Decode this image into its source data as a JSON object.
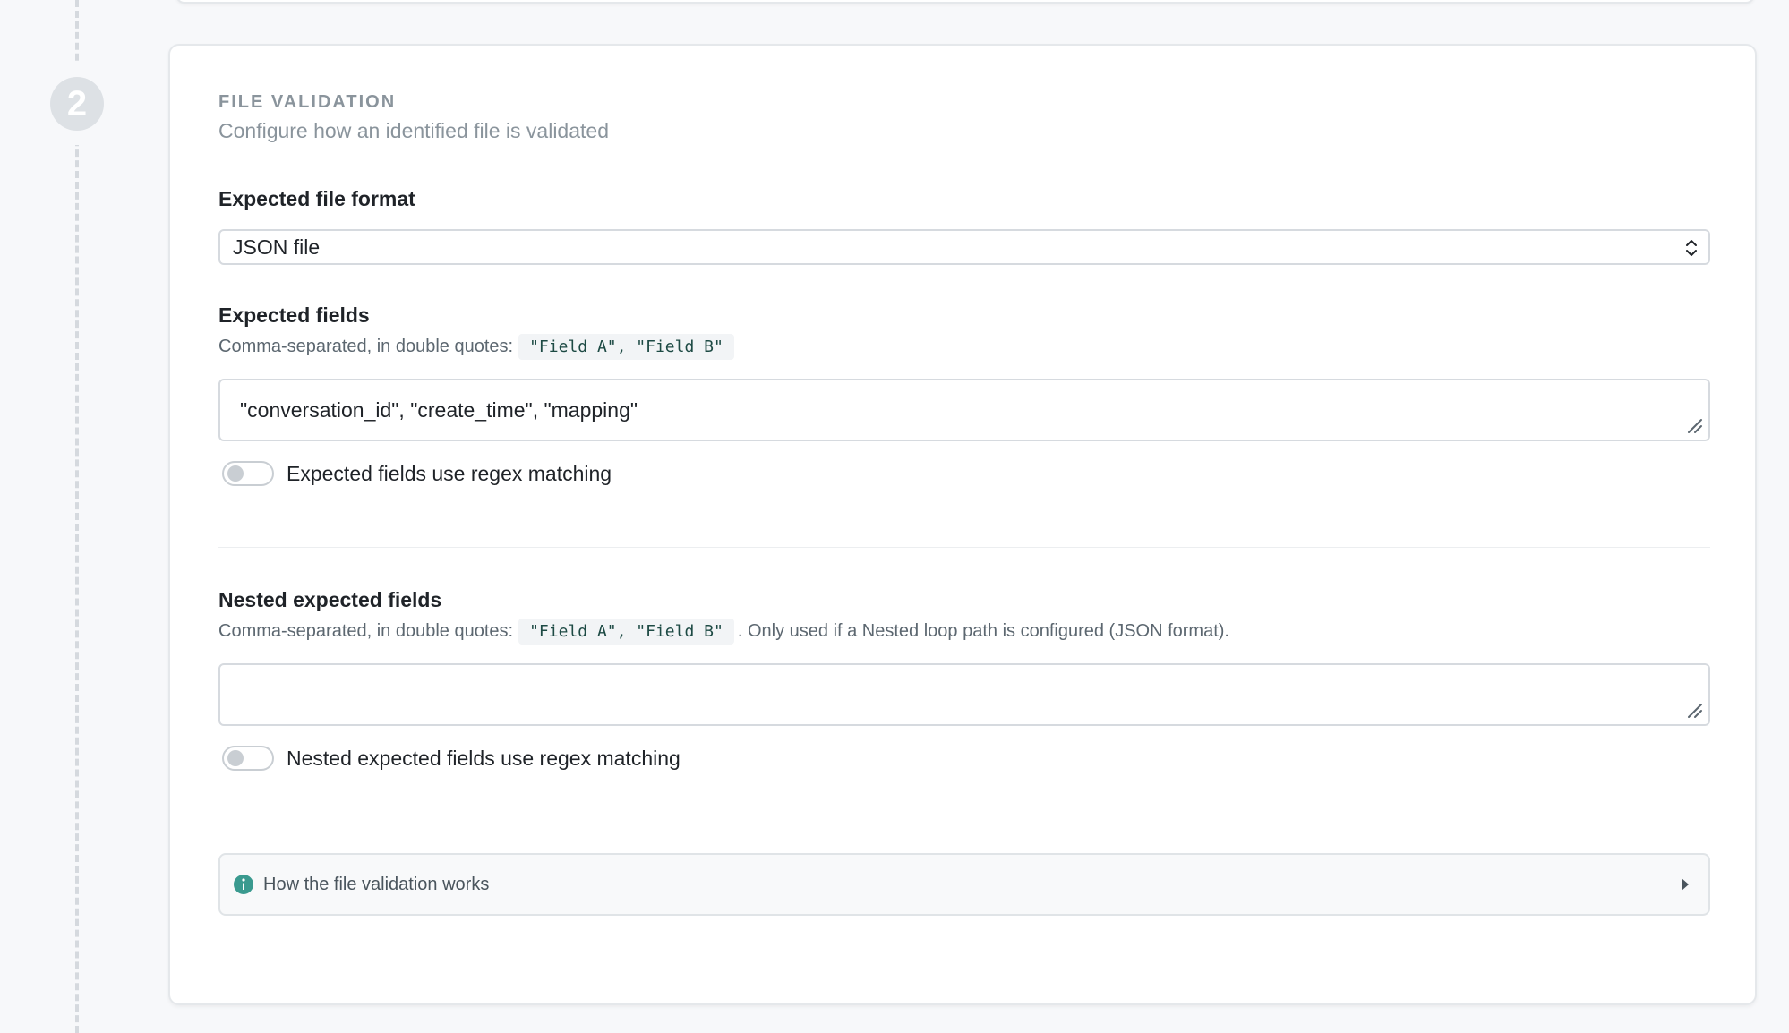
{
  "step": {
    "number": "2"
  },
  "section": {
    "title": "FILE VALIDATION",
    "subtitle": "Configure how an identified file is validated"
  },
  "file_format": {
    "label": "Expected file format",
    "selected": "JSON file"
  },
  "expected_fields": {
    "label": "Expected fields",
    "help_prefix": "Comma-separated, in double quotes:",
    "help_code": "\"Field A\", \"Field B\"",
    "value": "\"conversation_id\", \"create_time\", \"mapping\"",
    "toggle_label": "Expected fields use regex matching",
    "toggle_on": false
  },
  "nested_fields": {
    "label": "Nested expected fields",
    "help_prefix": "Comma-separated, in double quotes:",
    "help_code": "\"Field A\", \"Field B\"",
    "help_suffix": ". Only used if a Nested loop path is configured (JSON format).",
    "value": "",
    "toggle_label": "Nested expected fields use regex matching",
    "toggle_on": false
  },
  "info": {
    "title": "How the file validation works",
    "icon": "info-icon",
    "accent": "#3a9a8f"
  },
  "colors": {
    "page_bg": "#f7f8fa",
    "card_bg": "#ffffff",
    "muted_text": "#8a949c"
  }
}
